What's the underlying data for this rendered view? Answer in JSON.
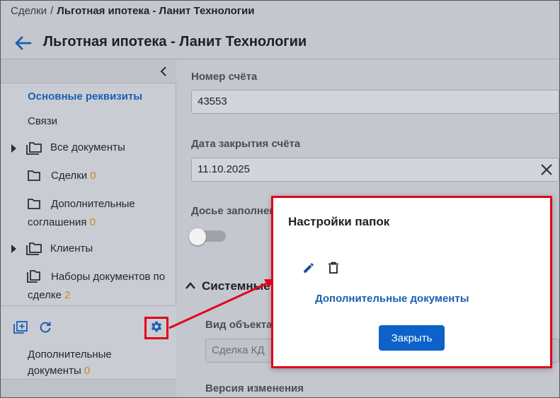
{
  "breadcrumb": {
    "root": "Сделки",
    "separator": "/",
    "current": "Льготная ипотека - Ланит Технологии"
  },
  "header": {
    "title": "Льготная ипотека - Ланит Технологии",
    "back_icon": "arrow-left-icon"
  },
  "sidebar": {
    "items": [
      {
        "label": "Основные реквизиты",
        "active": true
      },
      {
        "label": "Связи"
      },
      {
        "label": "Все документы",
        "icon": "folder-multiple-icon"
      },
      {
        "label": "Сделки",
        "count": "0",
        "icon": "folder-icon"
      },
      {
        "label_line1": "Дополнительные",
        "label_line2": "соглашения",
        "count": "0",
        "icon": "folder-icon"
      },
      {
        "label": "Клиенты",
        "icon": "folder-multiple-icon"
      },
      {
        "label_line1": "Наборы документов по",
        "label_line2": "сделке",
        "count": "2",
        "icon": "folder-copy-icon"
      }
    ],
    "footer": {
      "add_folder_icon": "add-folder-icon",
      "refresh_icon": "refresh-icon",
      "settings_icon": "gear-icon",
      "extra_folder_line1": "Дополнительные",
      "extra_folder_line2": "документы",
      "extra_folder_count": "0"
    }
  },
  "form": {
    "account_number_label": "Номер счёта",
    "account_number_value": "43553",
    "close_date_label": "Дата закрытия счёта",
    "close_date_value": "11.10.2025",
    "dossier_label": "Досье заполнен",
    "dossier_toggle_on": false,
    "system_section_title": "Системные",
    "object_type_label": "Вид объекта",
    "object_type_value": "Сделка КД",
    "version_label": "Версия изменения"
  },
  "dialog": {
    "title": "Настройки папок",
    "edit_icon": "pencil-icon",
    "delete_icon": "trash-icon",
    "folder_name": "Дополнительные документы",
    "close_label": "Закрыть"
  },
  "colors": {
    "accent": "#1a5fb4",
    "button": "#0d62c9",
    "highlight": "#e3001b",
    "count": "#c58a1a"
  }
}
